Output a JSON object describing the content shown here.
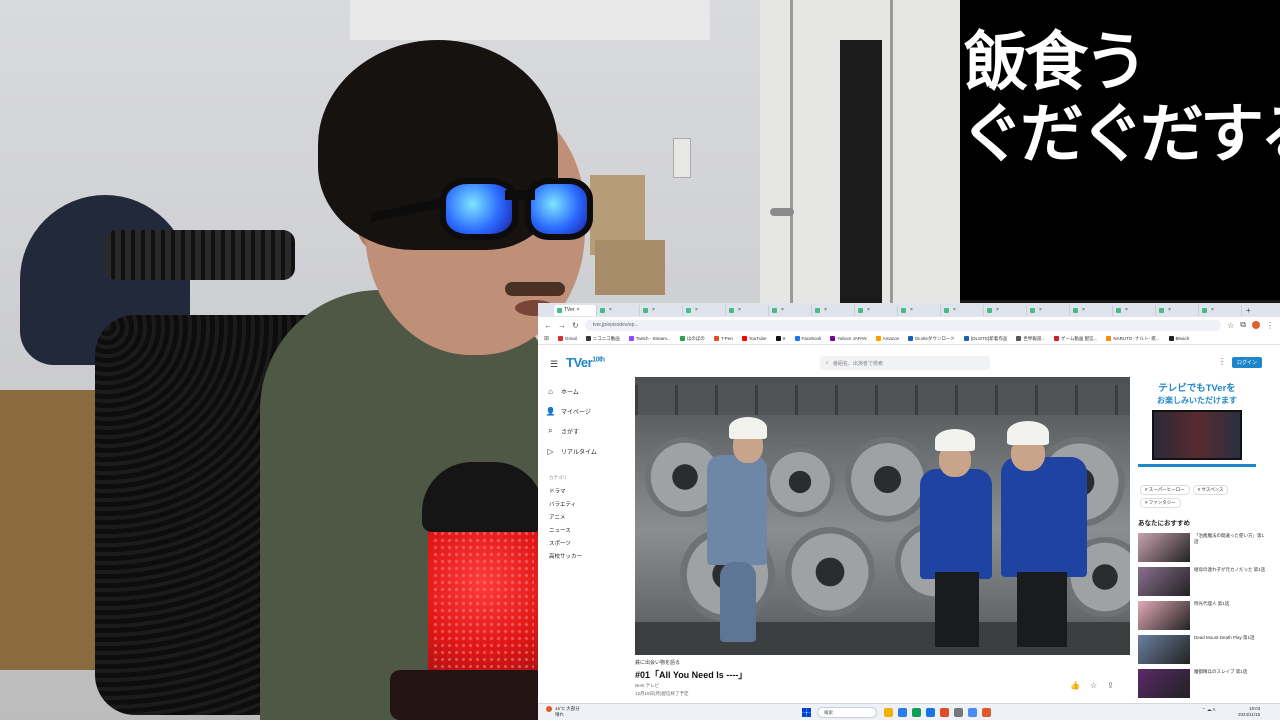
{
  "caption": {
    "line1": "飯食う",
    "line2": "ぐだぐだする"
  },
  "browser": {
    "tabs": [
      "TVer",
      "",
      "",
      "",
      "",
      "",
      "",
      "",
      "",
      "",
      "",
      "",
      "",
      "",
      "",
      ""
    ],
    "url": "tver.jp/episodes/ep...",
    "bookmarks": [
      {
        "label": "Gmail",
        "color": "#d93025"
      },
      {
        "label": "ニコニコ動画",
        "color": "#333333"
      },
      {
        "label": "Twitch - Stream...",
        "color": "#9146ff"
      },
      {
        "label": "ほのぼの",
        "color": "#2aa14a"
      },
      {
        "label": "T-Pen",
        "color": "#e34c26"
      },
      {
        "label": "YouTube",
        "color": "#ff0000"
      },
      {
        "label": "X",
        "color": "#111111"
      },
      {
        "label": "Facebook",
        "color": "#1877f2"
      },
      {
        "label": "Yahoo! JAPAN",
        "color": "#7b0099"
      },
      {
        "label": "Amazon",
        "color": "#ff9900"
      },
      {
        "label": "DLsiteダウンロード",
        "color": "#1c5fb8"
      },
      {
        "label": "[DLSITE]新着作品",
        "color": "#1c5fb8"
      },
      {
        "label": "世界報道...",
        "color": "#555555"
      },
      {
        "label": "ゲーム動画 配信...",
        "color": "#cc2222"
      },
      {
        "label": "NARUTO -ナルト- 疾...",
        "color": "#ff8800"
      },
      {
        "label": "Bleach",
        "color": "#222222"
      }
    ]
  },
  "tver": {
    "logo": "TVer",
    "logo_sup": "10th",
    "search_placeholder": "番組名、出演者で検索",
    "login_label": "ログイン",
    "nav": [
      {
        "label": "ホーム",
        "icon": "home-icon",
        "glyph": "⌂"
      },
      {
        "label": "マイページ",
        "icon": "user-icon",
        "glyph": "👤"
      },
      {
        "label": "さがす",
        "icon": "search-icon",
        "glyph": "⌕"
      },
      {
        "label": "リアルタイム",
        "icon": "live-icon",
        "glyph": "▷"
      }
    ],
    "category_label": "カテゴリ",
    "categories": [
      "ドラマ",
      "バラエティ",
      "アニメ",
      "ニュース",
      "スポーツ",
      "高校サッカー"
    ],
    "video": {
      "series": "鉄に出会い物を語る",
      "title": "#01「All You Need Is ----」",
      "sub1": "NHK テレビ",
      "sub2": "12月18日(月)配信終了予定"
    },
    "promo": {
      "line1": "テレビでもTVerを",
      "line2": "お楽しみいただけます"
    },
    "chips": [
      "# スーパーヒーロー",
      "# サスペンス",
      "# ファンタジー"
    ],
    "recommend_title": "あなたにおすすめ",
    "recommendations": [
      {
        "text": "「治癒魔法の間違った使い方」第1話",
        "color": "#c9a3b0"
      },
      {
        "text": "継母の連れ子が元カノだった 第1話",
        "color": "#8a6f8f"
      },
      {
        "text": "時光代理人 第1話",
        "color": "#e3a9b8"
      },
      {
        "text": "Dead Mount Death Play 第1話",
        "color": "#6a7fa0"
      },
      {
        "text": "魔都精兵のスレイブ 第1話",
        "color": "#5b2a6a"
      }
    ]
  },
  "taskbar": {
    "weather_line1": "16°C 大部分",
    "weather_line2": "晴れ",
    "search_label": "検索",
    "time": "19:03",
    "date": "2024/11/15",
    "apps": [
      "#f0b400",
      "#2b7de9",
      "#0f9d58",
      "#1a73e8",
      "#e34c26",
      "#777777",
      "#4b8bf5",
      "#e05a2b"
    ]
  }
}
